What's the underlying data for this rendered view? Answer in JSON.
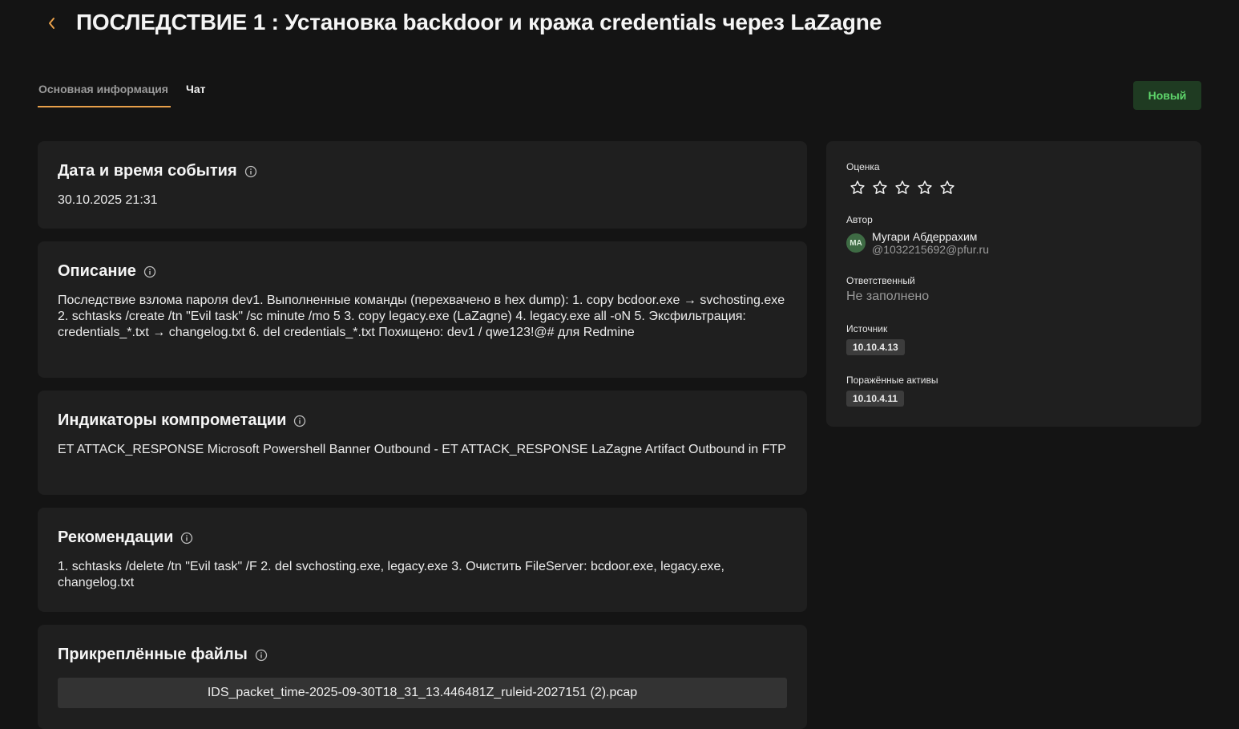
{
  "header": {
    "title": "ПОСЛЕДСТВИЕ 1 : Установка backdoor и кража credentials через LaZagne",
    "back_icon": "chevron-left-icon",
    "accent_color": "#e8a04a"
  },
  "tabs": [
    {
      "label": "Основная информация",
      "active": true
    },
    {
      "label": "Чат",
      "active": false
    }
  ],
  "status": {
    "label": "Новый",
    "color": "#5ed56b"
  },
  "sections": {
    "datetime": {
      "title": "Дата и время события",
      "value": "30.10.2025 21:31"
    },
    "description": {
      "title": "Описание",
      "text": "Последствие взлома пароля dev1. Выполненные команды (перехвачено в hex dump): 1. copy bcdoor.exe → svchosting.exe 2. schtasks /create /tn \"Evil task\" /sc minute /mo 5 3. copy legacy.exe (LaZagne) 4. legacy.exe all -oN 5. Эксфильтрация: credentials_*.txt → changelog.txt 6. del credentials_*.txt Похищено: dev1 / qwe123!@# для Redmine"
    },
    "indicators": {
      "title": "Индикаторы компрометации",
      "text": "ET ATTACK_RESPONSE Microsoft Powershell Banner Outbound - ET ATTACK_RESPONSE LaZagne Artifact Outbound in FTP"
    },
    "recommendations": {
      "title": "Рекомендации",
      "text": "1. schtasks /delete /tn \"Evil task\" /F 2. del svchosting.exe, legacy.exe 3. Очистить FileServer: bcdoor.exe, legacy.exe, changelog.txt"
    },
    "files": {
      "title": "Прикреплённые файлы",
      "items": [
        "IDS_packet_time-2025-09-30T18_31_13.446481Z_ruleid-2027151 (2).pcap"
      ]
    }
  },
  "sidebar": {
    "rating": {
      "label": "Оценка",
      "stars_total": 5,
      "stars_filled": 0
    },
    "author": {
      "label": "Автор",
      "initials": "MA",
      "name": "Мугари Абдеррахим",
      "email": "@1032215692@pfur.ru"
    },
    "responsible": {
      "label": "Ответственный",
      "value": "Не заполнено"
    },
    "source": {
      "label": "Источник",
      "value": "10.10.4.13"
    },
    "affected_assets": {
      "label": "Поражённые активы",
      "value": "10.10.4.11"
    }
  }
}
